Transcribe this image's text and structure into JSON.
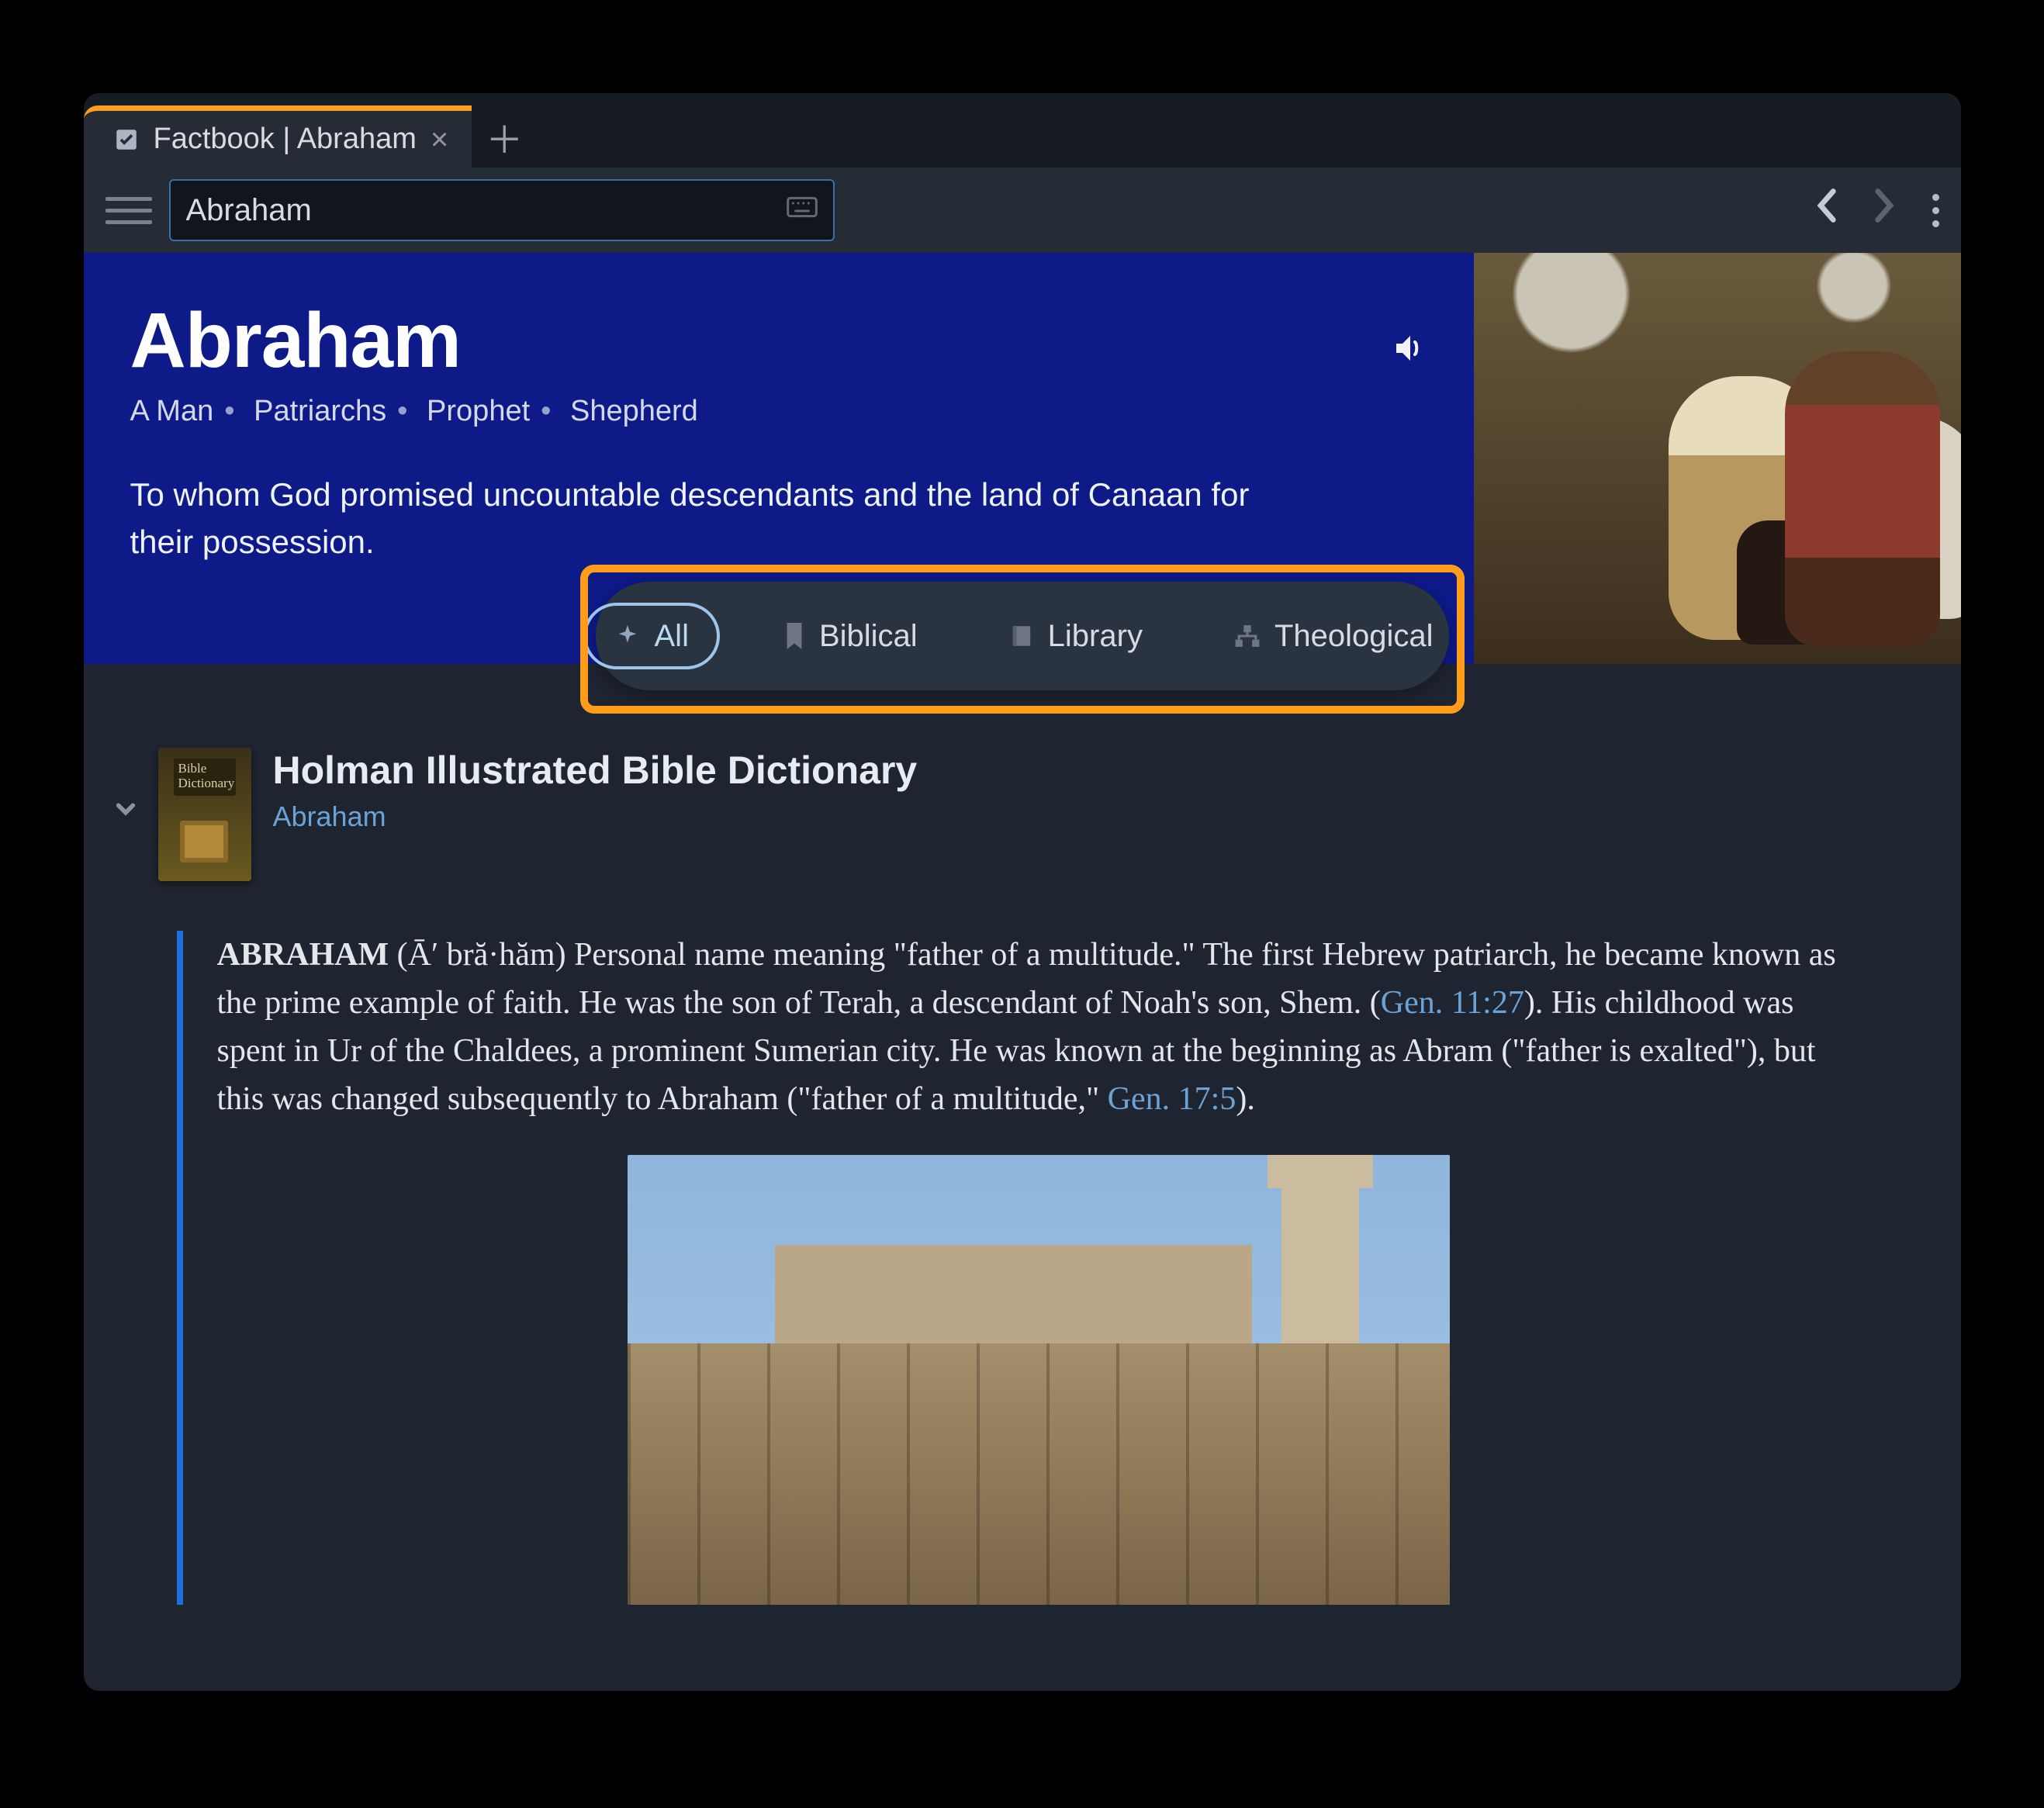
{
  "tab": {
    "title": "Factbook | Abraham"
  },
  "search": {
    "value": "Abraham"
  },
  "hero": {
    "title": "Abraham",
    "tags": [
      "A Man",
      "Patriarchs",
      "Prophet",
      "Shepherd"
    ],
    "description": "To whom God promised uncountable descendants and the land of Canaan for their possession."
  },
  "filters": {
    "items": [
      {
        "label": "All",
        "icon": "sparkle-icon",
        "active": true
      },
      {
        "label": "Biblical",
        "icon": "bookmark-icon",
        "active": false
      },
      {
        "label": "Library",
        "icon": "book-icon",
        "active": false
      },
      {
        "label": "Theological",
        "icon": "hierarchy-icon",
        "active": false
      }
    ]
  },
  "entry": {
    "cover_label": "Bible Dictionary",
    "source": "Holman Illustrated Bible Dictionary",
    "headword": "Abraham"
  },
  "article": {
    "lead_strong": "ABRAHAM",
    "pron": " (Āʹ bră·hăm) ",
    "seg1": "Personal name meaning \"father of a multitude.\" The first Hebrew patriarch, he became known as the prime example of faith. He was the son of Terah, a descendant of Noah's son, Shem. (",
    "ref1": "Gen. 11:27",
    "seg2": "). His childhood was spent in Ur of the Chaldees, a prominent Sumerian city. He was known at the beginning as Abram (\"father is exalted\"), but this was changed subsequently to Abraham (\"father of a multitude,\" ",
    "ref2": "Gen. 17:5",
    "seg3": ")."
  }
}
